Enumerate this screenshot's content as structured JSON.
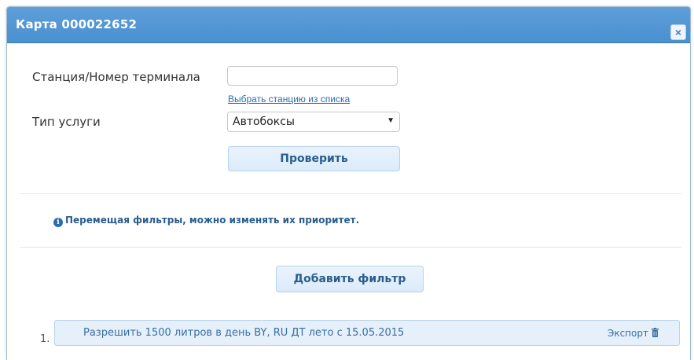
{
  "dialog": {
    "title": "Карта 000022652",
    "close_symbol": "×"
  },
  "form": {
    "station_label": "Станция/Номер терминала",
    "station_value": "",
    "select_station_link": "Выбрать станцию из списка",
    "service_type_label": "Тип услуги",
    "service_type_selected": "Автобоксы",
    "check_button": "Проверить"
  },
  "info": {
    "icon_symbol": "i",
    "text": "Перемещая фильтры, можно изменять их приоритет."
  },
  "filters": {
    "add_button": "Добавить фильтр",
    "items": [
      {
        "number": "1.",
        "text": "Разрешить 1500 литров в день BY, RU ДТ лето с 15.05.2015",
        "export_label": "Экспорт"
      }
    ]
  },
  "colors": {
    "titlebar": "#4a8fd0",
    "button_bg": "#dcebfa",
    "accent_text": "#2b5d8e",
    "link": "#2a6cb0"
  },
  "icons": {
    "close": "close-icon",
    "info": "info-icon",
    "trash": "trash-icon",
    "select_arrow": "chevron-down-icon"
  }
}
